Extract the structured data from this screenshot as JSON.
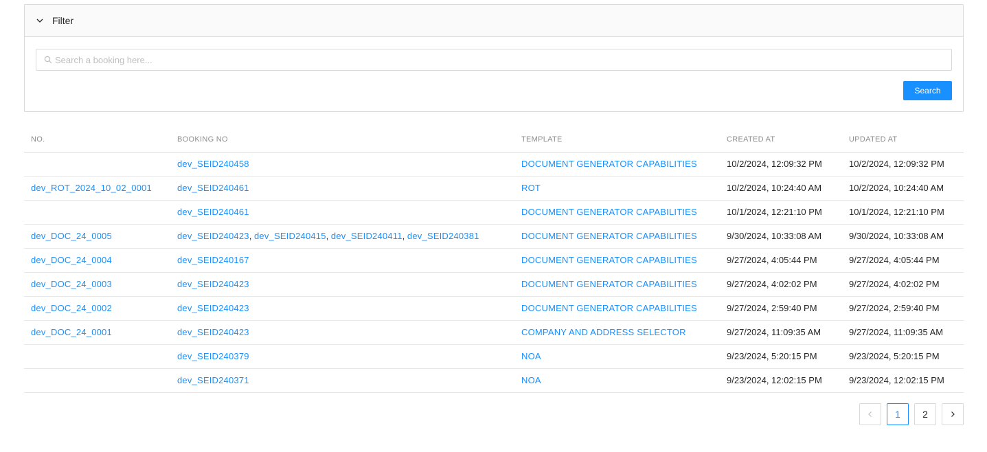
{
  "filter": {
    "title": "Filter",
    "search_placeholder": "Search a booking here...",
    "search_value": "",
    "search_button": "Search"
  },
  "table": {
    "headers": [
      "NO.",
      "BOOKING NO",
      "TEMPLATE",
      "CREATED AT",
      "UPDATED AT"
    ],
    "rows": [
      {
        "no": "",
        "bookings": [
          "dev_SEID240458"
        ],
        "template": "DOCUMENT GENERATOR CAPABILITIES",
        "created": "10/2/2024, 12:09:32 PM",
        "updated": "10/2/2024, 12:09:32 PM"
      },
      {
        "no": "dev_ROT_2024_10_02_0001",
        "bookings": [
          "dev_SEID240461"
        ],
        "template": "ROT",
        "created": "10/2/2024, 10:24:40 AM",
        "updated": "10/2/2024, 10:24:40 AM"
      },
      {
        "no": "",
        "bookings": [
          "dev_SEID240461"
        ],
        "template": "DOCUMENT GENERATOR CAPABILITIES",
        "created": "10/1/2024, 12:21:10 PM",
        "updated": "10/1/2024, 12:21:10 PM"
      },
      {
        "no": "dev_DOC_24_0005",
        "bookings": [
          "dev_SEID240423",
          "dev_SEID240415",
          "dev_SEID240411",
          "dev_SEID240381"
        ],
        "template": "DOCUMENT GENERATOR CAPABILITIES",
        "created": "9/30/2024, 10:33:08 AM",
        "updated": "9/30/2024, 10:33:08 AM"
      },
      {
        "no": "dev_DOC_24_0004",
        "bookings": [
          "dev_SEID240167"
        ],
        "template": "DOCUMENT GENERATOR CAPABILITIES",
        "created": "9/27/2024, 4:05:44 PM",
        "updated": "9/27/2024, 4:05:44 PM"
      },
      {
        "no": "dev_DOC_24_0003",
        "bookings": [
          "dev_SEID240423"
        ],
        "template": "DOCUMENT GENERATOR CAPABILITIES",
        "created": "9/27/2024, 4:02:02 PM",
        "updated": "9/27/2024, 4:02:02 PM"
      },
      {
        "no": "dev_DOC_24_0002",
        "bookings": [
          "dev_SEID240423"
        ],
        "template": "DOCUMENT GENERATOR CAPABILITIES",
        "created": "9/27/2024, 2:59:40 PM",
        "updated": "9/27/2024, 2:59:40 PM"
      },
      {
        "no": "dev_DOC_24_0001",
        "bookings": [
          "dev_SEID240423"
        ],
        "template": "COMPANY AND ADDRESS SELECTOR",
        "created": "9/27/2024, 11:09:35 AM",
        "updated": "9/27/2024, 11:09:35 AM"
      },
      {
        "no": "",
        "bookings": [
          "dev_SEID240379"
        ],
        "template": "NOA",
        "created": "9/23/2024, 5:20:15 PM",
        "updated": "9/23/2024, 5:20:15 PM"
      },
      {
        "no": "",
        "bookings": [
          "dev_SEID240371"
        ],
        "template": "NOA",
        "created": "9/23/2024, 12:02:15 PM",
        "updated": "9/23/2024, 12:02:15 PM"
      }
    ]
  },
  "pagination": {
    "pages": [
      "1",
      "2"
    ],
    "current": "1"
  },
  "colors": {
    "accent": "#1890ff",
    "border": "#d9d9d9",
    "header_text": "#8c8c8c"
  },
  "icons": {
    "filter_toggle": "chevron-down-icon",
    "search": "search-icon",
    "prev": "chevron-left-icon",
    "next": "chevron-right-icon"
  }
}
